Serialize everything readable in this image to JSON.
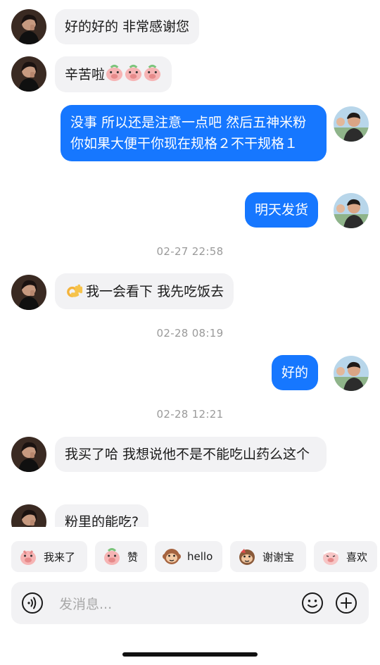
{
  "messages": [
    {
      "side": "in",
      "text": "好的好的 非常感谢您"
    },
    {
      "side": "in",
      "text": "辛苦啦",
      "emoji_count": 3,
      "emoji": "pig-face-emoji"
    },
    {
      "side": "out",
      "text": "没事 所以还是注意一点吧 然后五神米粉你如果大便干你现在规格２不干规格１"
    },
    {
      "side": "out",
      "text": "明天发货"
    },
    {
      "side": "in",
      "text": "我一会看下 我先吃饭去",
      "emoji": "ok-hand-emoji"
    },
    {
      "side": "out",
      "text": "好的"
    },
    {
      "side": "in",
      "text": "我买了哈 我想说他不是不能吃山药么这个"
    },
    {
      "side": "in",
      "text": "粉里的能吃?"
    }
  ],
  "timestamps": [
    "02-27 22:58",
    "02-28 08:19",
    "02-28 12:21"
  ],
  "quick_replies": [
    {
      "label": "我来了",
      "icon": "pig-sticker-icon"
    },
    {
      "label": "赞",
      "icon": "pig-sticker-icon"
    },
    {
      "label": "hello",
      "icon": "monkey-sticker-icon"
    },
    {
      "label": "谢谢宝",
      "icon": "monkey-sticker-icon"
    },
    {
      "label": "喜欢",
      "icon": "pig-sticker-icon"
    }
  ],
  "input": {
    "placeholder": "发消息...",
    "icons": [
      "voice-icon",
      "emoji-face-icon",
      "plus-icon"
    ]
  },
  "colors": {
    "accent": "#1677ff",
    "incoming_bg": "#f2f2f4",
    "timestamp": "#9a9a9a"
  }
}
